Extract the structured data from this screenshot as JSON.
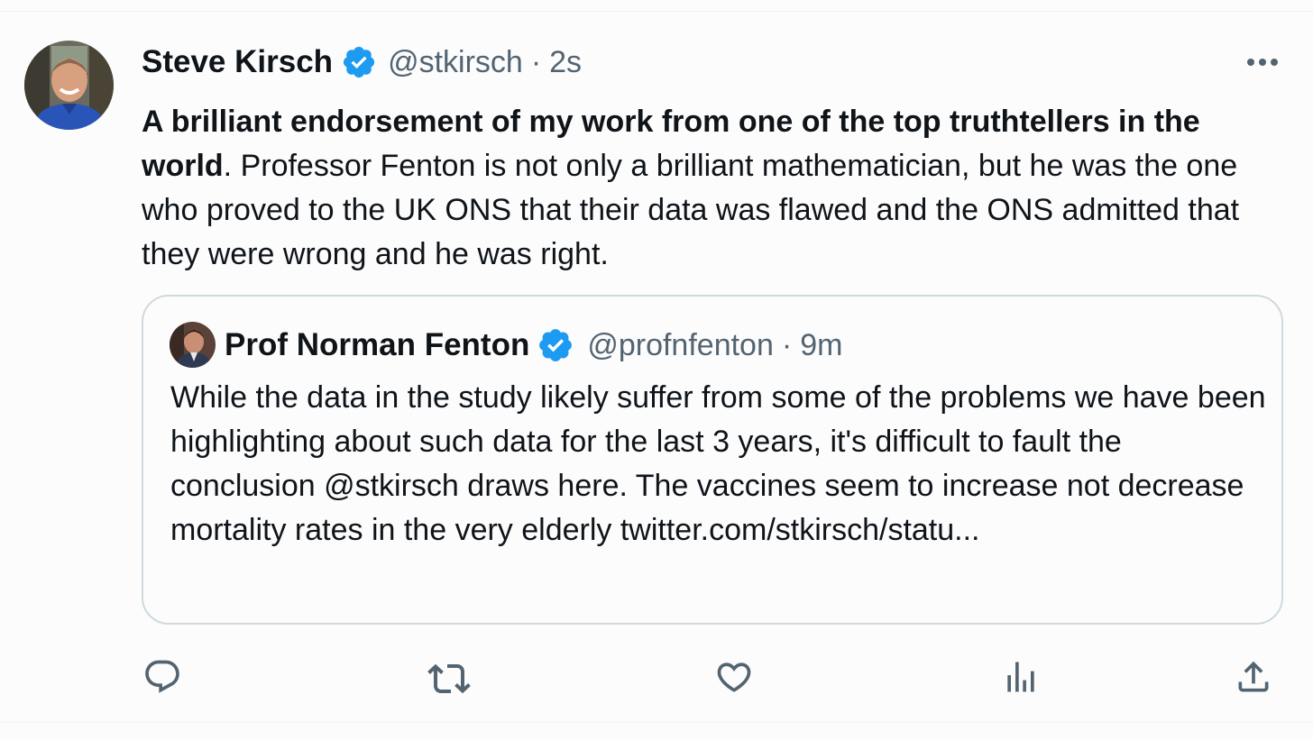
{
  "tweet": {
    "author_name": "Steve Kirsch",
    "author_handle": "@stkirsch",
    "separator": "·",
    "time": "2s",
    "text_bold": "A brilliant endorsement of my work from one of the top truthtellers in the world",
    "text_rest": ". Professor Fenton is not only a brilliant mathematician, but he was the one who proved to the UK ONS that their data was flawed and the ONS admitted that they were wrong and he was right."
  },
  "quote": {
    "author_name": "Prof Norman Fenton",
    "author_handle": "@profnfenton",
    "separator": "·",
    "time": "9m",
    "text": "While the data in the study likely suffer from some of the problems we have been highlighting about such data for the last 3 years, it's difficult to fault the conclusion @stkirsch draws here. The vaccines seem to increase not decrease mortality rates in the very elderly twitter.com/stkirsch/statu..."
  },
  "icons": {
    "more": "more-horizontal-icon",
    "verified": "verified-badge-icon",
    "reply": "reply-icon",
    "retweet": "retweet-icon",
    "like": "heart-icon",
    "views": "analytics-icon",
    "share": "share-icon"
  },
  "colors": {
    "verified_blue": "#1d9bf0",
    "secondary_text": "#536471",
    "border": "#cfd9de",
    "icon_gray": "#536471"
  }
}
